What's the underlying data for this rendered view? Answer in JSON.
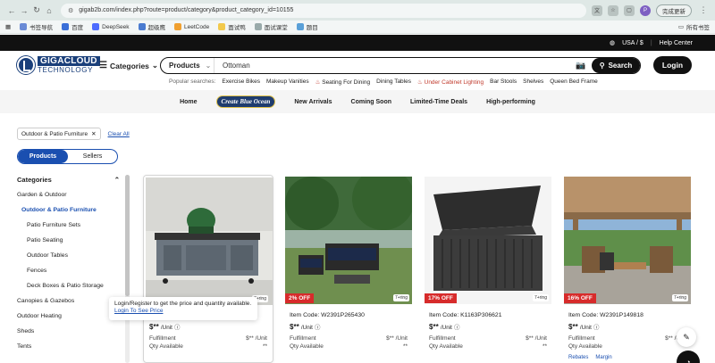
{
  "browser": {
    "url": "gigab2b.com/index.php?route=product/category&product_category_id=10155",
    "update_label": "完成更新",
    "avatar_letter": "P",
    "bookmarks": [
      "书签导航",
      "百度",
      "DeepSeek",
      "超级鹰",
      "LeetCode",
      "面试鸭",
      "面试课堂",
      "题目"
    ],
    "all_bookmarks": "所有书签"
  },
  "topbar": {
    "currency": "USA / $",
    "help": "Help Center"
  },
  "header": {
    "logo_line1": "GIGACLOUD",
    "logo_line2": "TECHNOLOGY",
    "categories_label": "Categories",
    "search_scope": "Products",
    "search_value": "Ottoman",
    "search_button": "Search",
    "login_button": "Login",
    "popular_label": "Popular searches:",
    "popular": [
      "Exercise Bikes",
      "Makeup Vanities",
      "Seating For Dining",
      "Dining Tables",
      "Under Cabinet Lighting",
      "Bar Stools",
      "Shelves",
      "Queen Bed Frame"
    ]
  },
  "nav": {
    "items": [
      "Home",
      "Create Blue Ocean",
      "New Arrivals",
      "Coming Soon",
      "Limited-Time Deals",
      "High-performing"
    ]
  },
  "filters": {
    "chip": "Outdoor & Patio Furniture",
    "clear_all": "Clear All",
    "toggle_products": "Products",
    "toggle_sellers": "Sellers"
  },
  "sidebar": {
    "title": "Categories",
    "items": [
      {
        "label": "Garden & Outdoor",
        "level": 1
      },
      {
        "label": "Outdoor & Patio Furniture",
        "level": 2
      },
      {
        "label": "Patio Furniture Sets",
        "level": 3
      },
      {
        "label": "Patio Seating",
        "level": 3
      },
      {
        "label": "Outdoor Tables",
        "level": 3
      },
      {
        "label": "Fences",
        "level": 3
      },
      {
        "label": "Deck Boxes & Patio Storage",
        "level": 3
      },
      {
        "label": "Canopies & Gazebos",
        "level": 1
      },
      {
        "label": "Outdoor Heating",
        "level": 1
      },
      {
        "label": "Sheds",
        "level": 1
      },
      {
        "label": "Tents",
        "level": 1
      }
    ]
  },
  "tooltip": {
    "text": "Login/Register to get the price and quantity available.",
    "link": "Login To See Price"
  },
  "products": [
    {
      "code": "",
      "discount": "",
      "ring": "7+ring",
      "price": "$**",
      "unit": "/Unit",
      "fulfillment": "Fulfillment",
      "ful_price": "$** /Unit",
      "qty": "Qty Available",
      "qty_val": "**"
    },
    {
      "code": "Item Code: W2391P265430",
      "discount": "2% OFF",
      "ring": "7+ring",
      "price": "$**",
      "unit": "/Unit",
      "fulfillment": "Fulfillment",
      "ful_price": "$** /Unit",
      "qty": "Qty Available",
      "qty_val": "**"
    },
    {
      "code": "Item Code: K1163P306621",
      "discount": "17% OFF",
      "ring": "7+ring",
      "price": "$**",
      "unit": "/Unit",
      "fulfillment": "Fulfillment",
      "ful_price": "$** /Unit",
      "qty": "Qty Available",
      "qty_val": "**"
    },
    {
      "code": "Item Code: W2391P149818",
      "discount": "16% OFF",
      "ring": "7+ring",
      "price": "$**",
      "unit": "/Unit",
      "fulfillment": "Fulfillment",
      "ful_price": "$** /Unit",
      "qty": "Qty Available",
      "qty_val": "**",
      "tags": [
        "Rebates",
        "Margin"
      ]
    }
  ]
}
